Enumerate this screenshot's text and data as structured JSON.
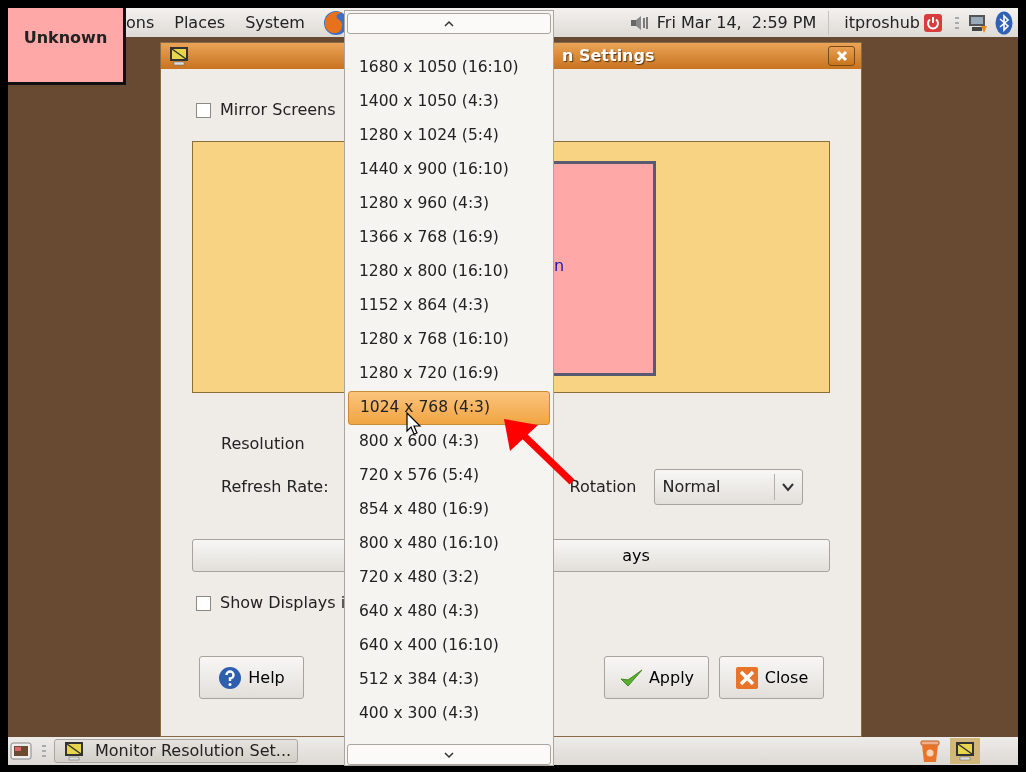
{
  "top_panel": {
    "menus": [
      "ons",
      "Places",
      "System"
    ],
    "clock": "Fri Mar 14,  2:59 PM",
    "user": "itproshub"
  },
  "overlay_label": "Unknown",
  "dialog": {
    "title": "n Settings",
    "mirror_screens": {
      "label": "Mirror Screens",
      "checked": false
    },
    "monitor_preview": {
      "label": "n"
    },
    "resolution_label": "Resolution",
    "refresh_rate_label": "Refresh Rate:",
    "rotation": {
      "label": "Rotation",
      "value": "Normal"
    },
    "detect_button": "ays",
    "show_displays": {
      "label": "Show Displays i",
      "checked": false
    },
    "buttons": [
      {
        "label": "Help",
        "kind": "help"
      },
      {
        "label": "Apply",
        "kind": "apply"
      },
      {
        "label": "Close",
        "kind": "close"
      }
    ]
  },
  "resolution_menu": {
    "items": [
      {
        "label": "1680 x 1050 (16:10)",
        "selected": false
      },
      {
        "label": "1400 x 1050 (4:3)",
        "selected": false
      },
      {
        "label": "1280 x 1024 (5:4)",
        "selected": false
      },
      {
        "label": "1440 x 900 (16:10)",
        "selected": false
      },
      {
        "label": "1280 x 960 (4:3)",
        "selected": false
      },
      {
        "label": "1366 x 768 (16:9)",
        "selected": false
      },
      {
        "label": "1280 x 800 (16:10)",
        "selected": false
      },
      {
        "label": "1152 x 864 (4:3)",
        "selected": false
      },
      {
        "label": "1280 x 768 (16:10)",
        "selected": false
      },
      {
        "label": "1280 x 720 (16:9)",
        "selected": false
      },
      {
        "label": "1024 x 768 (4:3)",
        "selected": true
      },
      {
        "label": "800 x 600 (4:3)",
        "selected": false
      },
      {
        "label": "720 x 576 (5:4)",
        "selected": false
      },
      {
        "label": "854 x 480 (16:9)",
        "selected": false
      },
      {
        "label": "800 x 480 (16:10)",
        "selected": false
      },
      {
        "label": "720 x 480 (3:2)",
        "selected": false
      },
      {
        "label": "640 x 480 (4:3)",
        "selected": false
      },
      {
        "label": "640 x 400 (16:10)",
        "selected": false
      },
      {
        "label": "512 x 384 (4:3)",
        "selected": false
      },
      {
        "label": "400 x 300 (4:3)",
        "selected": false
      }
    ]
  },
  "taskbar": {
    "tasks": [
      {
        "label": "Monitor Resolution Set..."
      }
    ]
  }
}
